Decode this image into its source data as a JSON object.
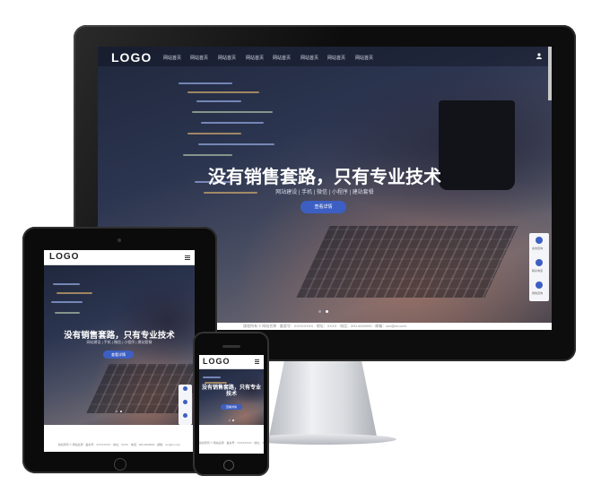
{
  "site": {
    "logo": "LOGO",
    "nav_items": [
      "网站首页",
      "网站首页",
      "网站首页",
      "网站首页",
      "网站首页",
      "网站首页",
      "网站首页",
      "网站首页"
    ],
    "hero_title": "没有销售套路，只有专业技术",
    "hero_subtitle": "网站建设 | 手机 | 微信 | 小程序 | 建站套餐",
    "cta_label": "查看详情",
    "footer_text": "版权所有 © 网站名称 · 备案号：XXXXXXXX · 地址：XXXX · 电话：000-0000000 · 邮箱：xxx@xx.com",
    "side_labels": [
      "在线咨询",
      "联系电话",
      "微信咨询"
    ],
    "slide_count": 2,
    "active_slide": 1
  },
  "colors": {
    "accent": "#3d5fc4",
    "nav_text": "#d7dbe6",
    "bezel": "#0d0d0d"
  },
  "icons": [
    "user-icon",
    "qq-icon",
    "phone-icon",
    "wechat-icon",
    "menu-icon"
  ]
}
